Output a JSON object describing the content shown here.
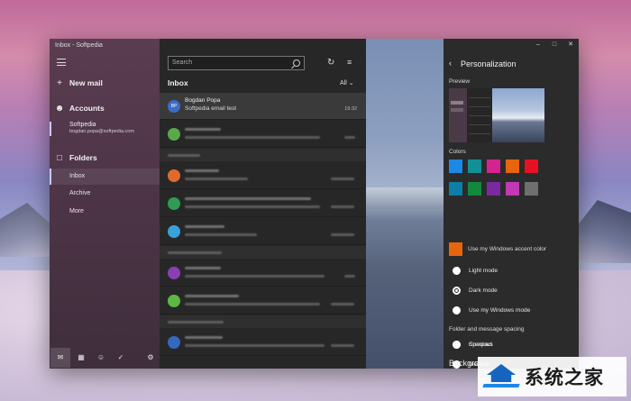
{
  "window": {
    "title": "Inbox - Softpedia"
  },
  "nav": {
    "new_mail": "New mail",
    "accounts": "Accounts",
    "account_name": "Softpedia",
    "account_email": "bogdan.popa@softpedia.com",
    "folders": "Folders",
    "folder_items": [
      "Inbox",
      "Archive",
      "More"
    ]
  },
  "list": {
    "search_placeholder": "Search",
    "heading": "Inbox",
    "filter_label": "All",
    "first_mail": {
      "initials": "BP",
      "sender": "Bogdan Popa",
      "subject": "Softpedia email test",
      "time": "19:32"
    }
  },
  "settings": {
    "title": "Personalization",
    "preview_label": "Preview",
    "colors_label": "Colors",
    "accent_label": "Use my Windows accent color",
    "modes": [
      "Light mode",
      "Dark mode",
      "Use my Windows mode"
    ],
    "spacing_label": "Folder and message spacing",
    "spacing_options": [
      "Spacious",
      "Medium",
      "Compact"
    ],
    "background_label": "Backgro"
  },
  "colors": {
    "swatches_row1": [
      "#1e88e5",
      "#138f96",
      "#d6238f",
      "#e8640f",
      "#e81123"
    ],
    "swatches_row2": [
      "#0b7fa7",
      "#128a3e",
      "#7a2aa1",
      "#c239b3",
      "#6f6f6f"
    ],
    "accent": "#e8640f",
    "avatar_colors": [
      "#3c6cc8",
      "#59a84a",
      "#e06a2e",
      "#2f9b55",
      "#3aa0d8",
      "#8a3fb3",
      "#5cb840",
      "#3568c0"
    ]
  },
  "watermark": {
    "text": "系统之家"
  }
}
